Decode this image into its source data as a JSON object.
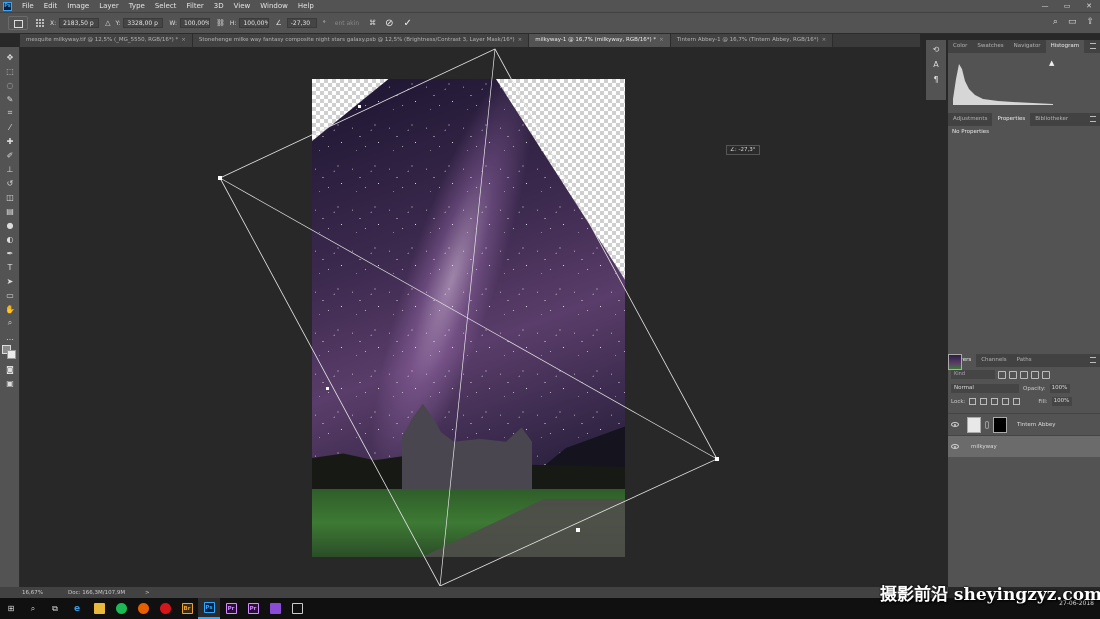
{
  "menu": [
    "File",
    "Edit",
    "Image",
    "Layer",
    "Type",
    "Select",
    "Filter",
    "3D",
    "View",
    "Window",
    "Help"
  ],
  "app_logo": "Ps",
  "window_controls": [
    "—",
    "▭",
    "✕"
  ],
  "options_bar": {
    "x_label": "X:",
    "x_value": "2183,50 p",
    "y_label": "Y:",
    "y_value": "3328,00 p",
    "w_label": "W:",
    "w_value": "100,00%",
    "link_icon": "link-icon",
    "h_label": "H:",
    "h_value": "100,00%",
    "angle_value": "-27,30",
    "angle_unit": "°",
    "warp_label": "ent akin",
    "cancel_icon": "⊘",
    "commit_icon": "✓"
  },
  "tabs": [
    {
      "label": "mesquite milkyway.tif @ 12,5% (_MG_5550, RGB/16*) *",
      "active": false
    },
    {
      "label": "Stonehenge milke way fantasy composite night stars galaxy.psb @ 12,5% (Brightness/Contrast 3, Layer Mask/16*)",
      "active": false
    },
    {
      "label": "milkyway-1 @ 16,7% (milkyway, RGB/16*) *",
      "active": true
    },
    {
      "label": "Tintern Abbey-1 @ 16,7% (Tintern Abbey, RGB/16*)",
      "active": false
    }
  ],
  "tab_close": "×",
  "angle_tooltip": "∠: -27,3°",
  "panels": {
    "top_tabs": [
      "Color",
      "Swatches",
      "Navigator",
      "Histogram"
    ],
    "top_active": "Histogram",
    "histogram_warning": "▲",
    "mid_tabs": [
      "Adjustments",
      "Properties",
      "Bibliotheker"
    ],
    "mid_active": "Properties",
    "no_properties": "No Properties",
    "layer_tabs": [
      "Layers",
      "Channels",
      "Paths"
    ],
    "layer_active": "Layers",
    "kind_placeholder": "Kind",
    "blend_mode": "Normal",
    "opacity_label": "Opacity:",
    "opacity_value": "100%",
    "lock_label": "Lock:",
    "fill_label": "Fill:",
    "fill_value": "100%",
    "layers": [
      {
        "name": "Tintern Abbey",
        "selected": false
      },
      {
        "name": "milkyway",
        "selected": true
      }
    ]
  },
  "status": {
    "zoom": "16,67%",
    "doc": "Doc: 166,3M/107,9M",
    "arrow": ">"
  },
  "taskbar": {
    "clock_time": "",
    "clock_date": "27-06-2018",
    "lang": "DAN"
  },
  "watermark": "摄影前沿 sheyingzyz.com"
}
